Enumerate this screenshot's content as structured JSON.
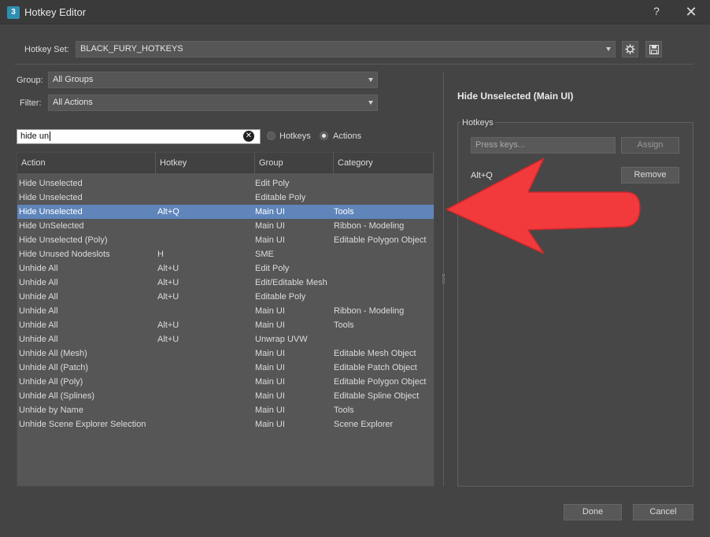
{
  "window": {
    "title": "Hotkey Editor",
    "app_icon_text": "3",
    "help_label": "?",
    "close_label": "✕"
  },
  "hotkey_set": {
    "label": "Hotkey Set:",
    "value": "BLACK_FURY_HOTKEYS"
  },
  "group": {
    "label": "Group:",
    "value": "All Groups"
  },
  "filter": {
    "label": "Filter:",
    "value": "All Actions"
  },
  "search": {
    "value": "hide un",
    "clear_label": "✕"
  },
  "search_mode": {
    "options": [
      {
        "label": "Hotkeys",
        "checked": false
      },
      {
        "label": "Actions",
        "checked": true
      }
    ]
  },
  "table": {
    "columns": [
      "Action",
      "Hotkey",
      "Group",
      "Category"
    ],
    "rows": [
      {
        "action": "Hide Unselected",
        "hotkey": "",
        "group": "Edit Poly",
        "category": ""
      },
      {
        "action": "Hide Unselected",
        "hotkey": "",
        "group": "Editable Poly",
        "category": ""
      },
      {
        "action": "Hide Unselected",
        "hotkey": "Alt+Q",
        "group": "Main UI",
        "category": "Tools",
        "selected": true
      },
      {
        "action": "Hide UnSelected",
        "hotkey": "",
        "group": "Main UI",
        "category": "Ribbon - Modeling"
      },
      {
        "action": "Hide Unselected (Poly)",
        "hotkey": "",
        "group": "Main UI",
        "category": "Editable Polygon Object"
      },
      {
        "action": "Hide Unused Nodeslots",
        "hotkey": "H",
        "group": "SME",
        "category": ""
      },
      {
        "action": "Unhide All",
        "hotkey": "Alt+U",
        "group": "Edit Poly",
        "category": ""
      },
      {
        "action": "Unhide All",
        "hotkey": "Alt+U",
        "group": "Edit/Editable Mesh",
        "category": ""
      },
      {
        "action": "Unhide All",
        "hotkey": "Alt+U",
        "group": "Editable Poly",
        "category": ""
      },
      {
        "action": "Unhide All",
        "hotkey": "",
        "group": "Main UI",
        "category": "Ribbon - Modeling"
      },
      {
        "action": "Unhide All",
        "hotkey": "Alt+U",
        "group": "Main UI",
        "category": "Tools"
      },
      {
        "action": "Unhide All",
        "hotkey": "Alt+U",
        "group": "Unwrap UVW",
        "category": ""
      },
      {
        "action": "Unhide All (Mesh)",
        "hotkey": "",
        "group": "Main UI",
        "category": "Editable Mesh Object"
      },
      {
        "action": "Unhide All (Patch)",
        "hotkey": "",
        "group": "Main UI",
        "category": "Editable Patch Object"
      },
      {
        "action": "Unhide All (Poly)",
        "hotkey": "",
        "group": "Main UI",
        "category": "Editable Polygon Object"
      },
      {
        "action": "Unhide All (Splines)",
        "hotkey": "",
        "group": "Main UI",
        "category": "Editable Spline Object"
      },
      {
        "action": "Unhide by Name",
        "hotkey": "",
        "group": "Main UI",
        "category": "Tools"
      },
      {
        "action": "Unhide Scene Explorer Selection",
        "hotkey": "",
        "group": "Main UI",
        "category": "Scene Explorer"
      }
    ]
  },
  "detail": {
    "title": "Hide Unselected (Main UI)",
    "hotkeys_group_label": "Hotkeys",
    "press_keys_placeholder": "Press keys...",
    "assign_label": "Assign",
    "assigned_hotkey": "Alt+Q",
    "remove_label": "Remove"
  },
  "footer": {
    "done_label": "Done",
    "cancel_label": "Cancel"
  },
  "colors": {
    "selection": "#5f85ba",
    "annotation_arrow": "#f2393c",
    "background": "#444444"
  }
}
